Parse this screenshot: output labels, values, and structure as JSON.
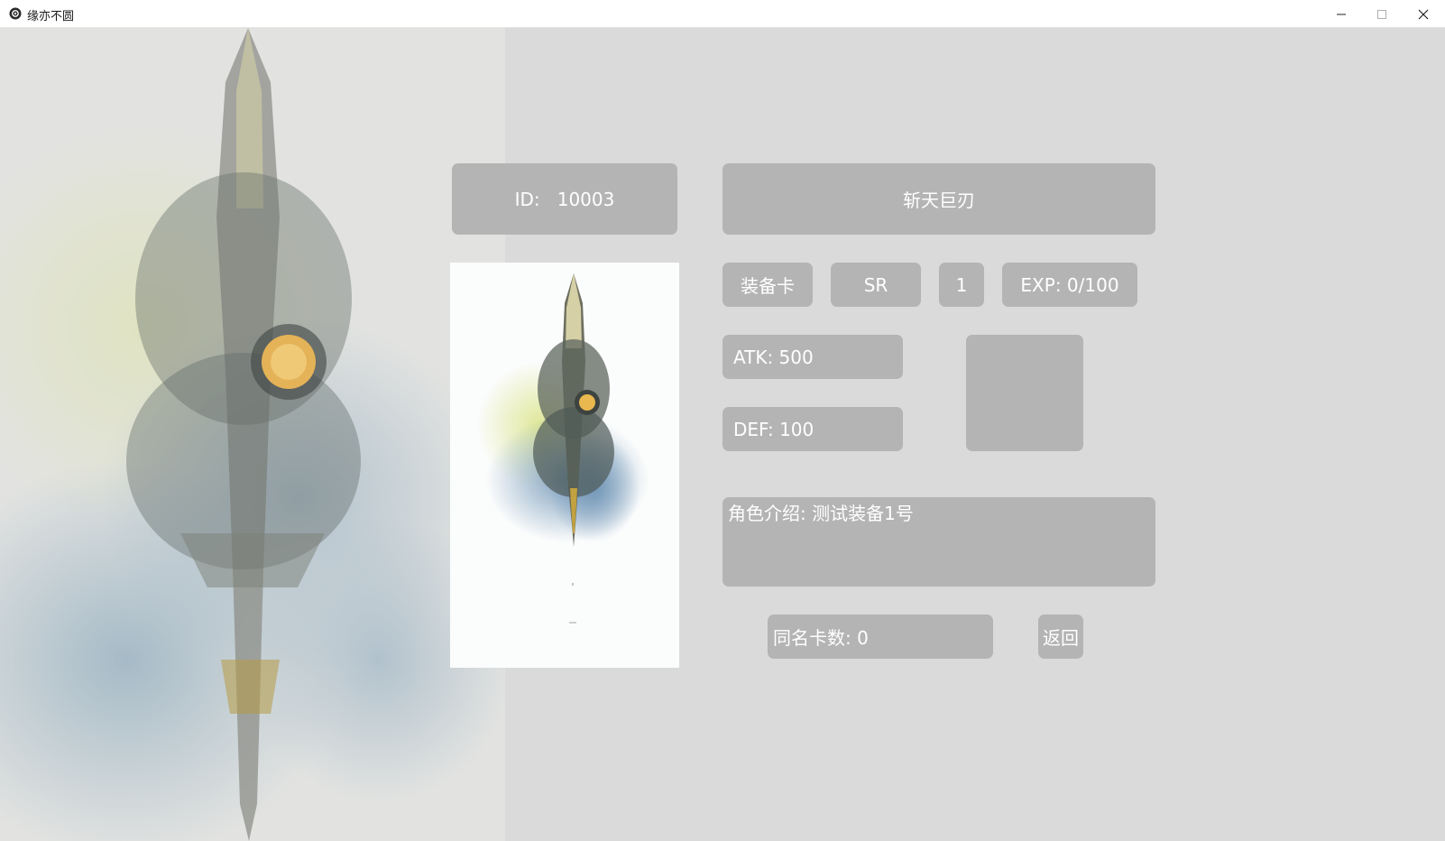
{
  "window": {
    "title": "缘亦不圆",
    "controls": {
      "minimize_icon": "minimize-icon",
      "maximize_icon": "maximize-icon",
      "close_icon": "close-icon"
    }
  },
  "card": {
    "id_label": "ID:   10003",
    "name": "斩天巨刃",
    "type": "装备卡",
    "rarity": "SR",
    "level": "1",
    "exp": "EXP: 0/100",
    "atk": "ATK: 500",
    "def": "DEF: 100",
    "description": "角色介绍: 测试装备1号",
    "duplicates": "同名卡数: 0"
  },
  "actions": {
    "back_label": "返回"
  },
  "colors": {
    "window_bg": "#dadada",
    "panel_bg": "#b4b4b4",
    "panel_text": "#ffffff",
    "titlebar_bg": "#ffffff"
  }
}
